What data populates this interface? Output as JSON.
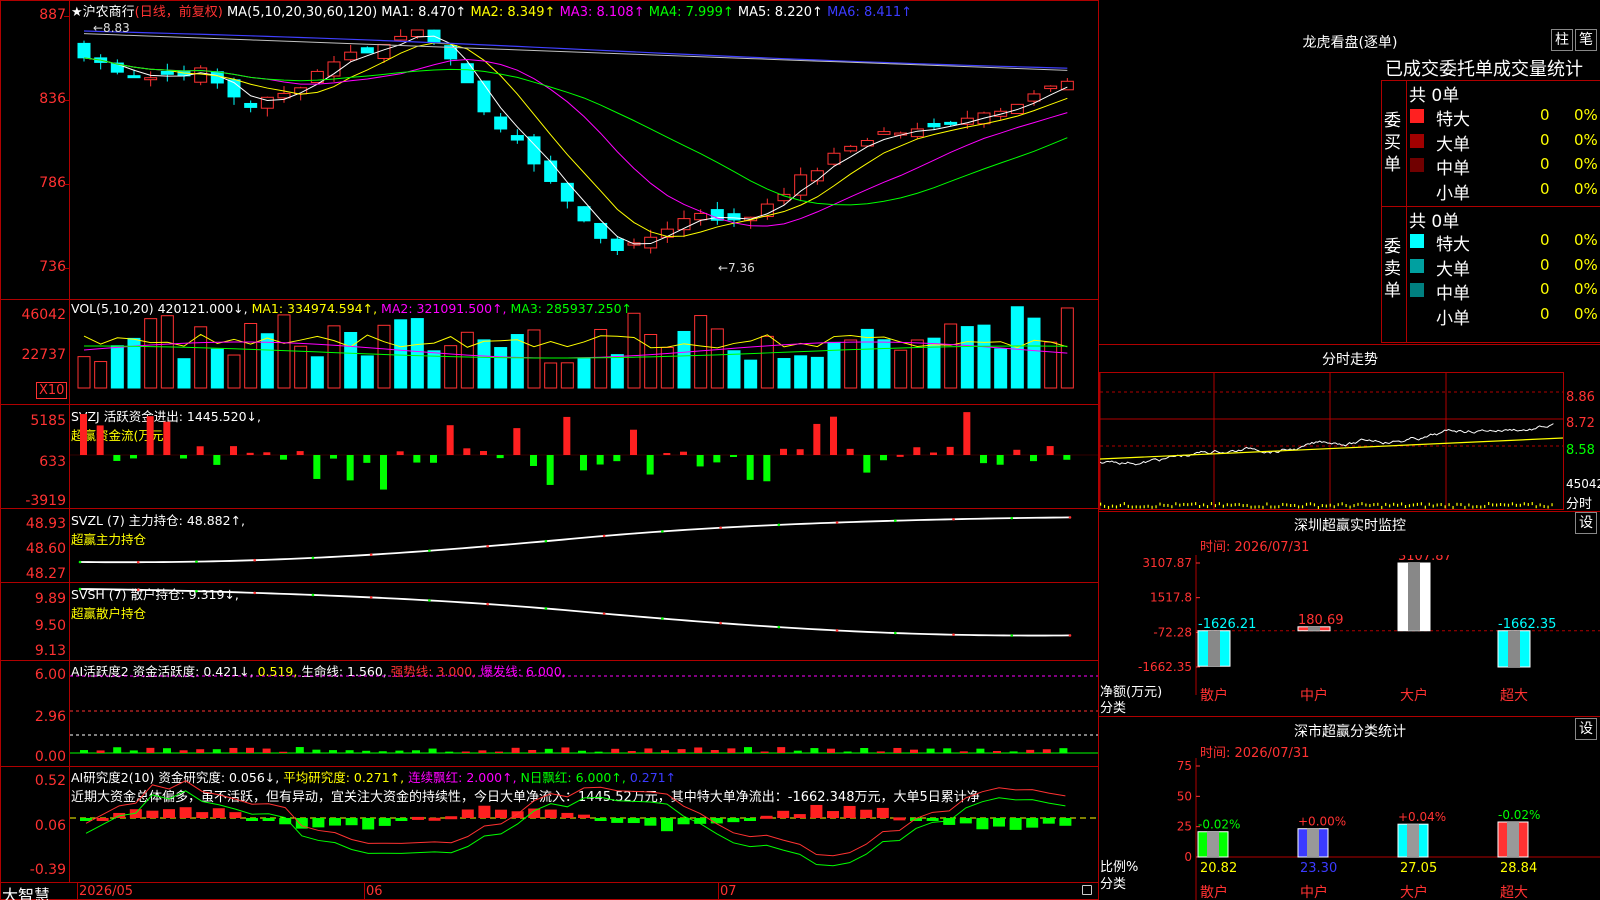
{
  "header": {
    "star": "★",
    "stock_name": "沪农商行",
    "period": "(日线，前复权)",
    "ma_label": "MA(5,10,20,30,60,120)",
    "ma1": "MA1: 8.470↑",
    "ma2": "MA2: 8.349↑",
    "ma3": "MA3: 8.108↑",
    "ma4": "MA4: 7.999↑",
    "ma5": "MA5: 8.220↑",
    "ma6": "MA6: 8.411↑"
  },
  "price_axis": [
    "887",
    "836",
    "786",
    "736"
  ],
  "price_marks": {
    "high": "←8.83",
    "low": "←7.36"
  },
  "vol": {
    "label": "VOL(5,10,20)",
    "value": "420121.000↓,",
    "ma1": "MA1: 334974.594↑,",
    "ma2": "MA2: 321091.500↑,",
    "ma3": "MA3: 285937.250↑",
    "axis": [
      "46042",
      "22737"
    ],
    "unit": "X10"
  },
  "svzj": {
    "label": "SVZJ  活跃资金进出: 1445.520↓,",
    "sub": "超赢资金流(万元)",
    "axis": [
      "5185",
      "633",
      "-3919"
    ]
  },
  "svzl": {
    "label": "SVZL (7) 主力持仓: 48.882↑,",
    "sub": "超赢主力持仓",
    "axis": [
      "48.93",
      "48.60",
      "48.27"
    ]
  },
  "svsh": {
    "label": "SVSH (7) 散户持仓: 9.319↓,",
    "sub": "超赢散户持仓",
    "axis": [
      "9.89",
      "9.50",
      "9.13"
    ]
  },
  "ai1": {
    "label_a": "AI活跃度2 资金活跃度: 0.421↓,",
    "label_b": "0.519,",
    "label_c": "生命线: 1.560,",
    "label_d": "强势线: 3.000,",
    "label_e": "爆发线: 6.000,",
    "axis": [
      "6.00",
      "2.96",
      "0.00"
    ]
  },
  "ai2": {
    "label_a": "AI研究度2(10) 资金研究度: 0.056↓,",
    "label_b": "平均研究度: 0.271↑,",
    "label_c": "连续飘红: 2.000↑,",
    "label_d": "N日飘红: 6.000↑,",
    "label_e": "0.271↑",
    "comment": "近期大资金总体偏多，虽不活跃，但有异动，宜关注大资金的持续性，今日大单净流入：1445.52万元，其中特大单净流出：-1662.348万元，大单5日累计净",
    "axis": [
      "0.52",
      "0.06",
      "-0.39"
    ]
  },
  "bottom_bar": {
    "brand": "大智慧",
    "date1": "2026/05",
    "date2": "06",
    "date3": "07"
  },
  "right": {
    "lhb_title": "龙虎看盘(逐单)",
    "btn_zhu": "柱",
    "btn_bi": "笔",
    "order_heading": "已成交委托单成交量统计",
    "buy_group": {
      "side": "委买单",
      "total": "共 0单",
      "rows": [
        {
          "name": "特大",
          "count": "0",
          "pct": "0%",
          "color": "#ff2020"
        },
        {
          "name": "大单",
          "count": "0",
          "pct": "0%",
          "color": "#a00000"
        },
        {
          "name": "中单",
          "count": "0",
          "pct": "0%",
          "color": "#700000"
        },
        {
          "name": "小单",
          "count": "0",
          "pct": "0%",
          "color": "#000000"
        }
      ]
    },
    "sell_group": {
      "side": "委卖单",
      "total": "共 0单",
      "rows": [
        {
          "name": "特大",
          "count": "0",
          "pct": "0%",
          "color": "#00ffff"
        },
        {
          "name": "大单",
          "count": "0",
          "pct": "0%",
          "color": "#00a0a0"
        },
        {
          "name": "中单",
          "count": "0",
          "pct": "0%",
          "color": "#008080"
        },
        {
          "name": "小单",
          "count": "0",
          "pct": "0%",
          "color": "#000000"
        }
      ]
    },
    "intraday": {
      "title": "分时走势",
      "price_axis": [
        "8.86",
        "8.72",
        "8.58"
      ],
      "vol_axis": [
        "45042",
        "分时"
      ]
    },
    "monitor": {
      "title": "深圳超赢实时监控",
      "btn": "设",
      "time": "时间: 2026/07/31",
      "axis": [
        "3107.87",
        "1517.8",
        "-72.28",
        "-1662.35"
      ],
      "ylabel": "净额(万元)",
      "xlabel": "分类",
      "categories": [
        "散户",
        "中户",
        "大户",
        "超大"
      ],
      "values": [
        "-1626.21",
        "180.69",
        "3107.87",
        "-1662.35"
      ]
    },
    "classify": {
      "title": "深市超赢分类统计",
      "btn": "设",
      "time": "时间: 2026/07/31",
      "axis": [
        "75",
        "50",
        "25",
        "0"
      ],
      "ylabel": "比例%",
      "xlabel": "分类",
      "categories": [
        "散户",
        "中户",
        "大户",
        "超大"
      ],
      "changes": [
        "-0.02%",
        "+0.00%",
        "+0.04%",
        "-0.02%"
      ],
      "values": [
        "20.82",
        "23.30",
        "27.05",
        "28.84"
      ]
    }
  },
  "chart_data": [
    {
      "type": "bar",
      "title": "深圳超赢实时监控",
      "ylabel": "净额(万元)",
      "xlabel": "分类",
      "categories": [
        "散户",
        "中户",
        "大户",
        "超大"
      ],
      "values": [
        -1626.21,
        180.69,
        3107.87,
        -1662.35
      ],
      "ylim": [
        -1662.35,
        3107.87
      ]
    },
    {
      "type": "bar",
      "title": "深市超赢分类统计",
      "ylabel": "比例%",
      "xlabel": "分类",
      "categories": [
        "散户",
        "中户",
        "大户",
        "超大"
      ],
      "values": [
        20.82,
        23.3,
        27.05,
        28.84
      ],
      "ylim": [
        0,
        75
      ]
    },
    {
      "type": "bar",
      "title": "沪农商行 (日线，前复权)",
      "ylabel": "",
      "ylim": [
        7.36,
        8.87
      ],
      "categories": [
        "2026/05",
        "06",
        "07"
      ],
      "values": [
        8.83,
        7.36,
        8.47
      ]
    }
  ]
}
